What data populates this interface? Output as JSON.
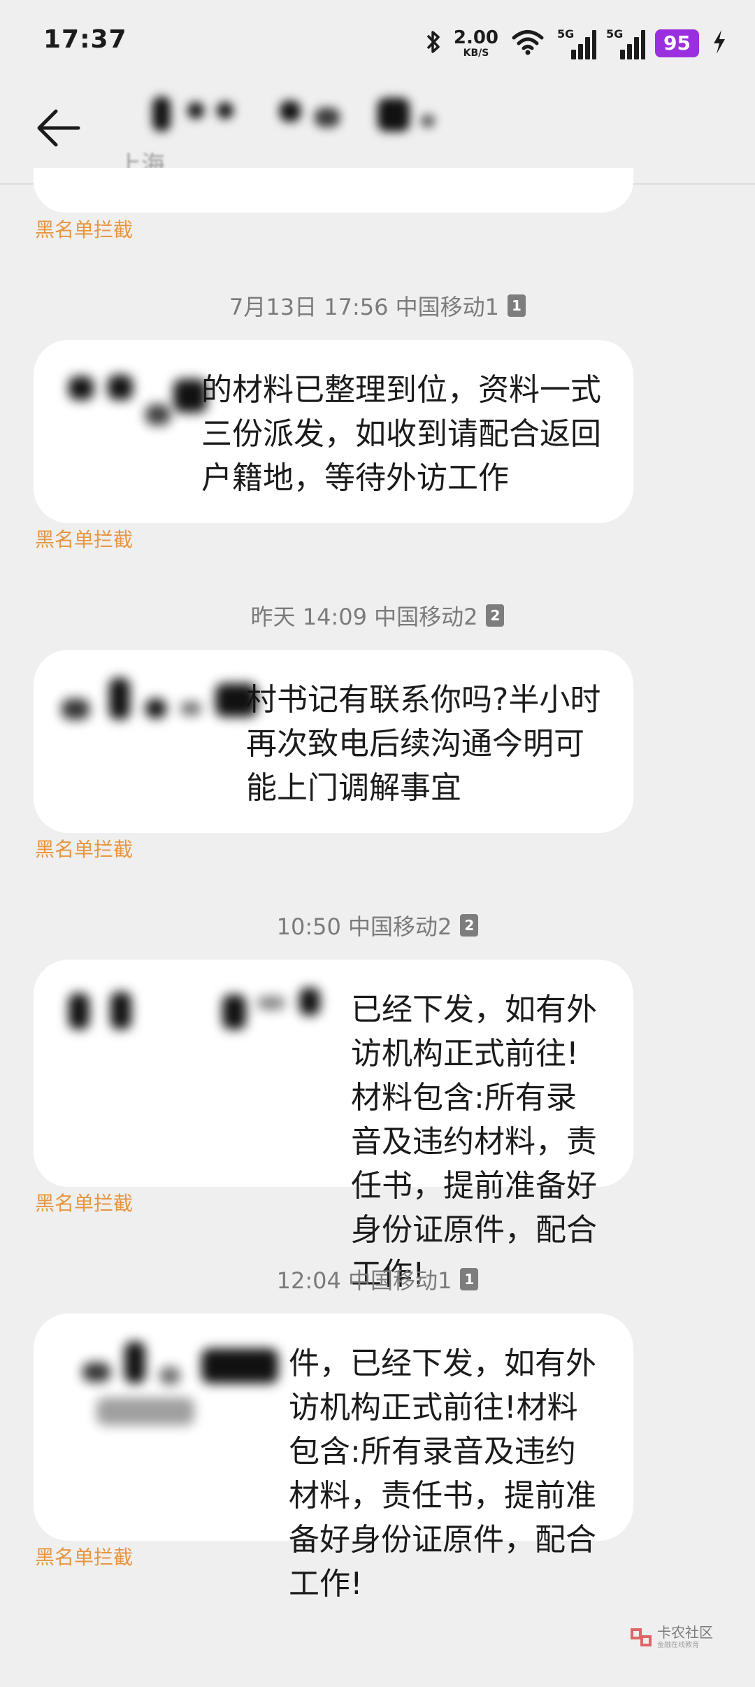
{
  "status_bar": {
    "time": "17:37",
    "net_speed_value": "2.00",
    "net_speed_unit": "KB/S",
    "signal1_label": "5G",
    "signal2_label": "5G",
    "battery": "95",
    "icons": [
      "bluetooth-icon",
      "wifi-icon",
      "signal-icon",
      "signal-icon",
      "charging-icon"
    ],
    "battery_color": "#9a2fe0"
  },
  "header": {
    "back_icon": "arrow-left-icon",
    "contact_name": "",
    "location": "上海"
  },
  "colors": {
    "block_label": "#e7953f",
    "bubble": "#ffffff",
    "background": "#efefef"
  },
  "top_block_label": "黑名单拦截",
  "messages": [
    {
      "datetime": "7月13日 17:56 中国移动1",
      "sim": "1",
      "text": "的材料已整理到位，资料一式三份派发，如收到请配合返回户籍地，等待外访工作",
      "block_label": "黑名单拦截"
    },
    {
      "datetime": "昨天 14:09 中国移动2",
      "sim": "2",
      "text": "村书记有联系你吗?半小时再次致电后续沟通今明可能上门调解事宜",
      "block_label": "黑名单拦截"
    },
    {
      "datetime": "10:50 中国移动2",
      "sim": "2",
      "text": "已经下发，如有外访机构正式前往!材料包含:所有录音及违约材料，责任书，提前准备好身份证原件，配合工作!",
      "block_label": "黑名单拦截"
    },
    {
      "datetime": "12:04 中国移动1",
      "sim": "1",
      "text": "件，已经下发，如有外访机构正式前往!材料包含:所有录音及违约材料，责任书，提前准备好身份证原件，配合工作!",
      "block_label": "黑名单拦截"
    }
  ],
  "watermark": {
    "title": "卡农社区",
    "subtitle": "金融在线教育"
  }
}
